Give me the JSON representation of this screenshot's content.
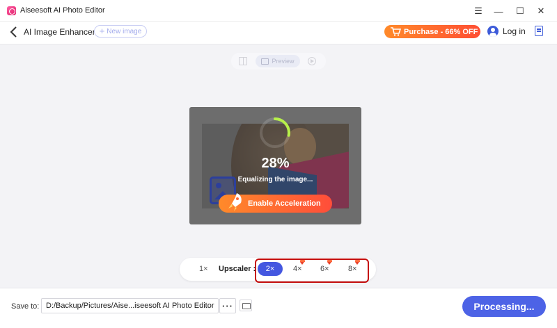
{
  "window": {
    "title": "Aiseesoft AI Photo Editor",
    "controls": {
      "menu": "☰",
      "minimize": "—",
      "maximize": "☐",
      "close": "✕"
    }
  },
  "toolbar": {
    "title": "AI Image Enhancer",
    "new_image_label": "New image",
    "purchase_label": "Purchase - 66% OFF",
    "login_label": "Log in"
  },
  "view_toggle": {
    "preview_label": "Preview"
  },
  "processing": {
    "percent": "28%",
    "progress_fraction": 0.28,
    "status": "Equalizing the image...",
    "acceleration_label": "Enable Acceleration"
  },
  "upscaler": {
    "label": "Upscaler :",
    "options": [
      "1×",
      "2×",
      "4×",
      "6×",
      "8×"
    ],
    "selected": "2×"
  },
  "bottom": {
    "save_to_label": "Save to:",
    "path": "D:/Backup/Pictures/Aise...iseesoft AI Photo Editor",
    "more_label": "···",
    "process_label": "Processing..."
  },
  "colors": {
    "accent": "#4d63e6",
    "purchase": "#ff5a33",
    "highlight": "#c40d0d"
  }
}
